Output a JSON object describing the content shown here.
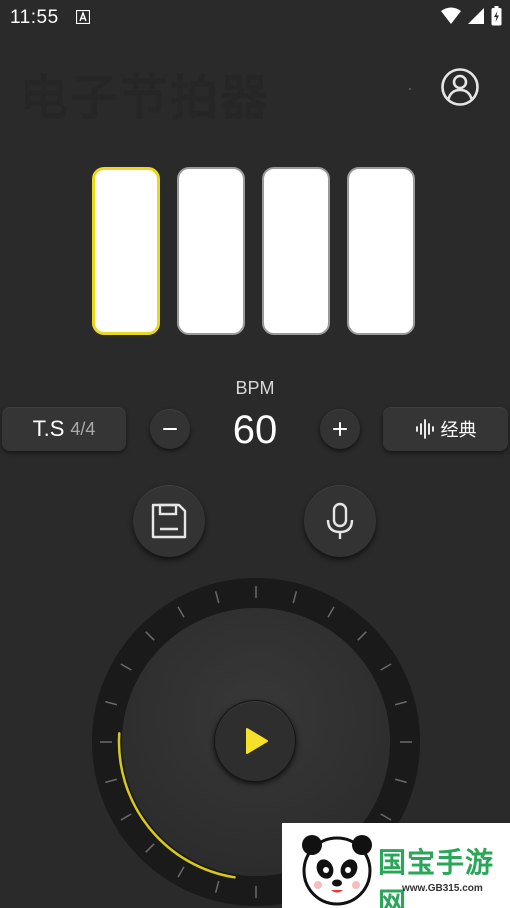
{
  "status_bar": {
    "time": "11:55"
  },
  "header": {
    "title": "电子节拍器",
    "profile_icon": "user-circle-icon"
  },
  "beats": {
    "count": 4,
    "active_index": 0
  },
  "bpm": {
    "label": "BPM",
    "value": "60"
  },
  "time_signature": {
    "label": "T.S",
    "value": "4/4"
  },
  "sound": {
    "label": "经典",
    "icon": "waveform-icon"
  },
  "controls": {
    "minus_icon": "minus-icon",
    "plus_icon": "plus-icon",
    "save_icon": "floppy-disk-icon",
    "mic_icon": "microphone-icon",
    "play_icon": "play-icon"
  },
  "ad": {
    "brand": "国宝手游网",
    "url": "www.GB315.com"
  },
  "colors": {
    "background": "#2a2a2a",
    "accent": "#e8d920",
    "beat_pad": "#ffffff",
    "ad_green": "#2aa55a"
  }
}
